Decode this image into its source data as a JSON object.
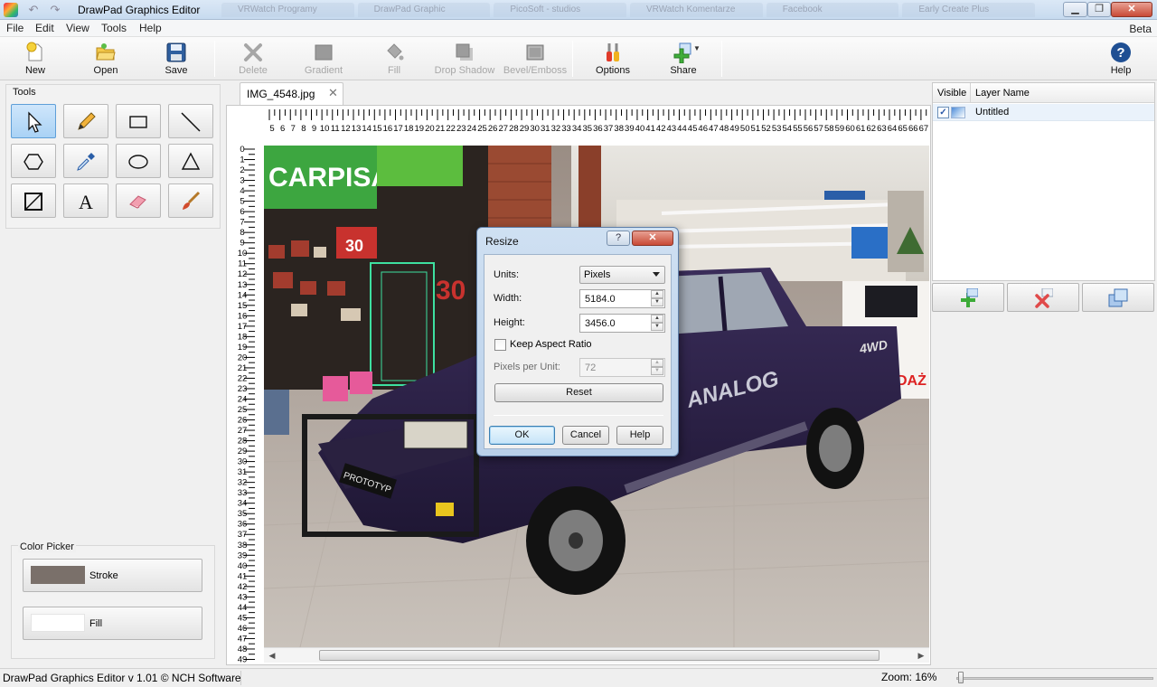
{
  "window": {
    "title": "DrawPad Graphics Editor",
    "background_tabs": [
      "VRWatch Programy",
      "DrawPad Graphic",
      "PicoSoft - studios",
      "VRWatch Komentarze",
      "Facebook",
      "Early Create Plus"
    ]
  },
  "menu": {
    "items": [
      "File",
      "Edit",
      "View",
      "Tools",
      "Help"
    ],
    "beta_label": "Beta"
  },
  "toolbar": {
    "new_label": "New",
    "open_label": "Open",
    "save_label": "Save",
    "delete_label": "Delete",
    "gradient_label": "Gradient",
    "fill_label": "Fill",
    "drop_shadow_label": "Drop Shadow",
    "bevel_emboss_label": "Bevel/Emboss",
    "options_label": "Options",
    "share_label": "Share",
    "help_label": "Help"
  },
  "tools_panel": {
    "title": "Tools",
    "tools": [
      "select-tool",
      "pencil-tool",
      "rectangle-tool",
      "line-tool",
      "polygon-tool",
      "eyedropper-tool",
      "ellipse-tool",
      "triangle-tool",
      "crop-tool",
      "text-tool",
      "eraser-tool",
      "brush-tool"
    ],
    "active_tool": "select-tool"
  },
  "color_picker": {
    "title": "Color Picker",
    "stroke_label": "Stroke",
    "stroke_color": "#7a706a",
    "fill_label": "Fill",
    "fill_color": "#ffffff"
  },
  "document": {
    "tab_label": "IMG_4548.jpg",
    "close_glyph": "✕"
  },
  "rulers": {
    "top_start": 5,
    "top_end": 67,
    "left_start": 0,
    "left_end": 49
  },
  "layers": {
    "col_visible": "Visible",
    "col_layer_name": "Layer Name",
    "rows": [
      {
        "name": "Untitled",
        "visible": true
      }
    ]
  },
  "resize_dialog": {
    "title": "Resize",
    "help_glyph": "?",
    "close_glyph": "✕",
    "units_label": "Units:",
    "units_value": "Pixels",
    "width_label": "Width:",
    "width_value": "5184.0",
    "height_label": "Height:",
    "height_value": "3456.0",
    "keep_aspect_label": "Keep Aspect Ratio",
    "keep_aspect_checked": false,
    "ppu_label": "Pixels per Unit:",
    "ppu_value": "72",
    "reset_label": "Reset",
    "ok_label": "OK",
    "cancel_label": "Cancel",
    "help_label": "Help"
  },
  "statusbar": {
    "text": "DrawPad Graphics Editor v 1.01 © NCH Software",
    "zoom_label": "Zoom: 16%"
  },
  "photo": {
    "sign_text": "CARPISA",
    "sale_text": "30",
    "truck_text": "ANALOG",
    "plate_text": "PROTOTYP",
    "badge_text": "4WD",
    "shop_text": "DAŻ"
  },
  "colors": {
    "accent": "#3c7fb1",
    "dialog_frame": "#b9d0ea",
    "close_red": "#c94a36"
  }
}
